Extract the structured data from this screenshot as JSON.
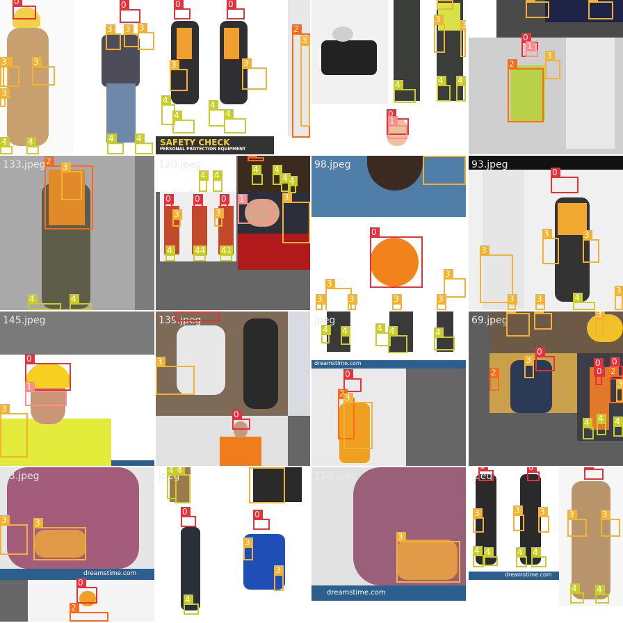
{
  "palette": {
    "0": "#e8303a",
    "1": "#ff8d8d",
    "2": "#ff6a1a",
    "3": "#f2b233",
    "4": "#c8cc2e"
  },
  "tiles": [
    {
      "file": "",
      "boxes": [
        "0",
        "3",
        "3",
        "3",
        "3",
        "4",
        "4",
        "0",
        "3",
        "3",
        "3",
        "4",
        "4"
      ]
    },
    {
      "file": "",
      "boxes": [
        "0",
        "0",
        "3",
        "3",
        "4",
        "4",
        "4",
        "4",
        "2",
        "3"
      ],
      "banner": "SAFETY CHECK",
      "banner_sub": "PERSONAL PROTECTION EQUIPMENT"
    },
    {
      "file": "",
      "boxes": [
        "3",
        "3",
        "3",
        "4",
        "4",
        "4",
        "0",
        "1"
      ]
    },
    {
      "file": "",
      "boxes": [
        "3",
        "3",
        "0",
        "1",
        "3",
        "2"
      ]
    },
    {
      "file": "133.jpeg",
      "boxes": [
        "2",
        "3",
        "4",
        "4"
      ]
    },
    {
      "file": "120.jpeg",
      "boxes": [
        "2",
        "4",
        "4",
        "4",
        "4",
        "4",
        "4",
        "0",
        "3",
        "0",
        "0",
        "3",
        "4",
        "44",
        "41",
        "1",
        "3"
      ]
    },
    {
      "file": "98.jpeg",
      "boxes": [
        "3",
        "0",
        "3",
        "3",
        "3",
        "3",
        "3",
        "3"
      ]
    },
    {
      "file": "93.jpeg",
      "boxes": [
        "0",
        "3",
        "3",
        "3",
        "3",
        "3",
        "4",
        "3"
      ]
    },
    {
      "file": "145.jpeg",
      "boxes": [
        "0",
        "1",
        "3"
      ]
    },
    {
      "file": "139.jpeg",
      "boxes": [
        "01",
        "3",
        "0"
      ]
    },
    {
      "file": "jpeg",
      "boxes": [
        "4",
        "4",
        "4",
        "4",
        "4",
        "0",
        "2",
        "3"
      ],
      "watermark": "dreamstime.com"
    },
    {
      "file": "69.jpeg",
      "boxes": [
        "3",
        "3",
        "3",
        "0",
        "0",
        "2",
        "3",
        "0",
        "0",
        "2",
        "3",
        "4",
        "4",
        "4"
      ]
    },
    {
      "file": "63.jpeg",
      "boxes": [
        "3",
        "3",
        "0",
        "2"
      ],
      "watermark": "dreamstime.com"
    },
    {
      "file": "jpeg",
      "boxes": [
        "4",
        "4",
        "3",
        "0",
        "0",
        "3",
        "3",
        "4"
      ]
    },
    {
      "file": "114.jpeg",
      "boxes": [
        "3"
      ],
      "watermark": "dreamstime.com"
    },
    {
      "file": "jpeg",
      "boxes": [
        "0",
        "0",
        "0",
        "3",
        "3",
        "3",
        "3",
        "3",
        "4",
        "4",
        "4",
        "4",
        "4",
        "4"
      ],
      "watermark": "dreamstime.com"
    }
  ]
}
